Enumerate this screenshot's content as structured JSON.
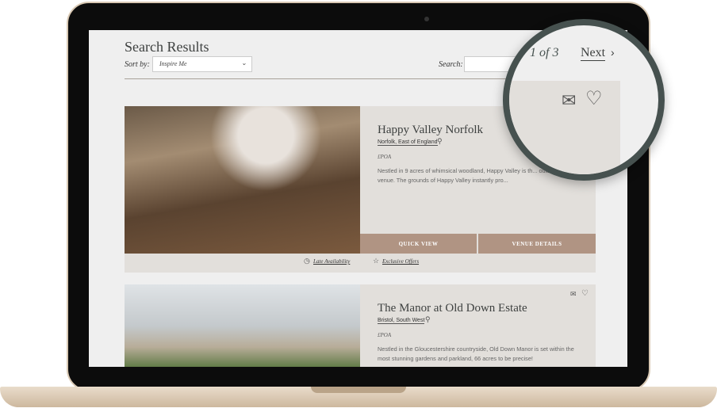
{
  "header": {
    "title": "Search Results",
    "sort_label": "Sort by:",
    "sort_value": "Inspire Me",
    "search_label": "Search:",
    "search_value": ""
  },
  "pagination": {
    "page_text": "1 of 3",
    "next_label": "Next"
  },
  "venues": [
    {
      "name": "Happy Valley Norfolk",
      "location": "Norfolk, East of England",
      "price": "£POA",
      "description": "Nestled in 9 acres of whimsical woodland, Happy Valley is th... outdoor wedding venue. The grounds of Happy Valley instantly pro...",
      "quick_view": "QUICK VIEW",
      "venue_details": "VENUE DETAILS",
      "late_availability": "Late Availability",
      "exclusive_offers": "Exclusive Offers"
    },
    {
      "name": "The Manor at Old Down Estate",
      "location": "Bristol, South West",
      "price": "£POA",
      "description": "Nestled in the Gloucestershire countryside, Old Down Manor is set within the most stunning gardens and parkland, 66 acres to be precise!"
    }
  ],
  "colors": {
    "accent": "#b09483",
    "panel": "#e2dfdb",
    "magnifier_ring": "#46514f"
  }
}
